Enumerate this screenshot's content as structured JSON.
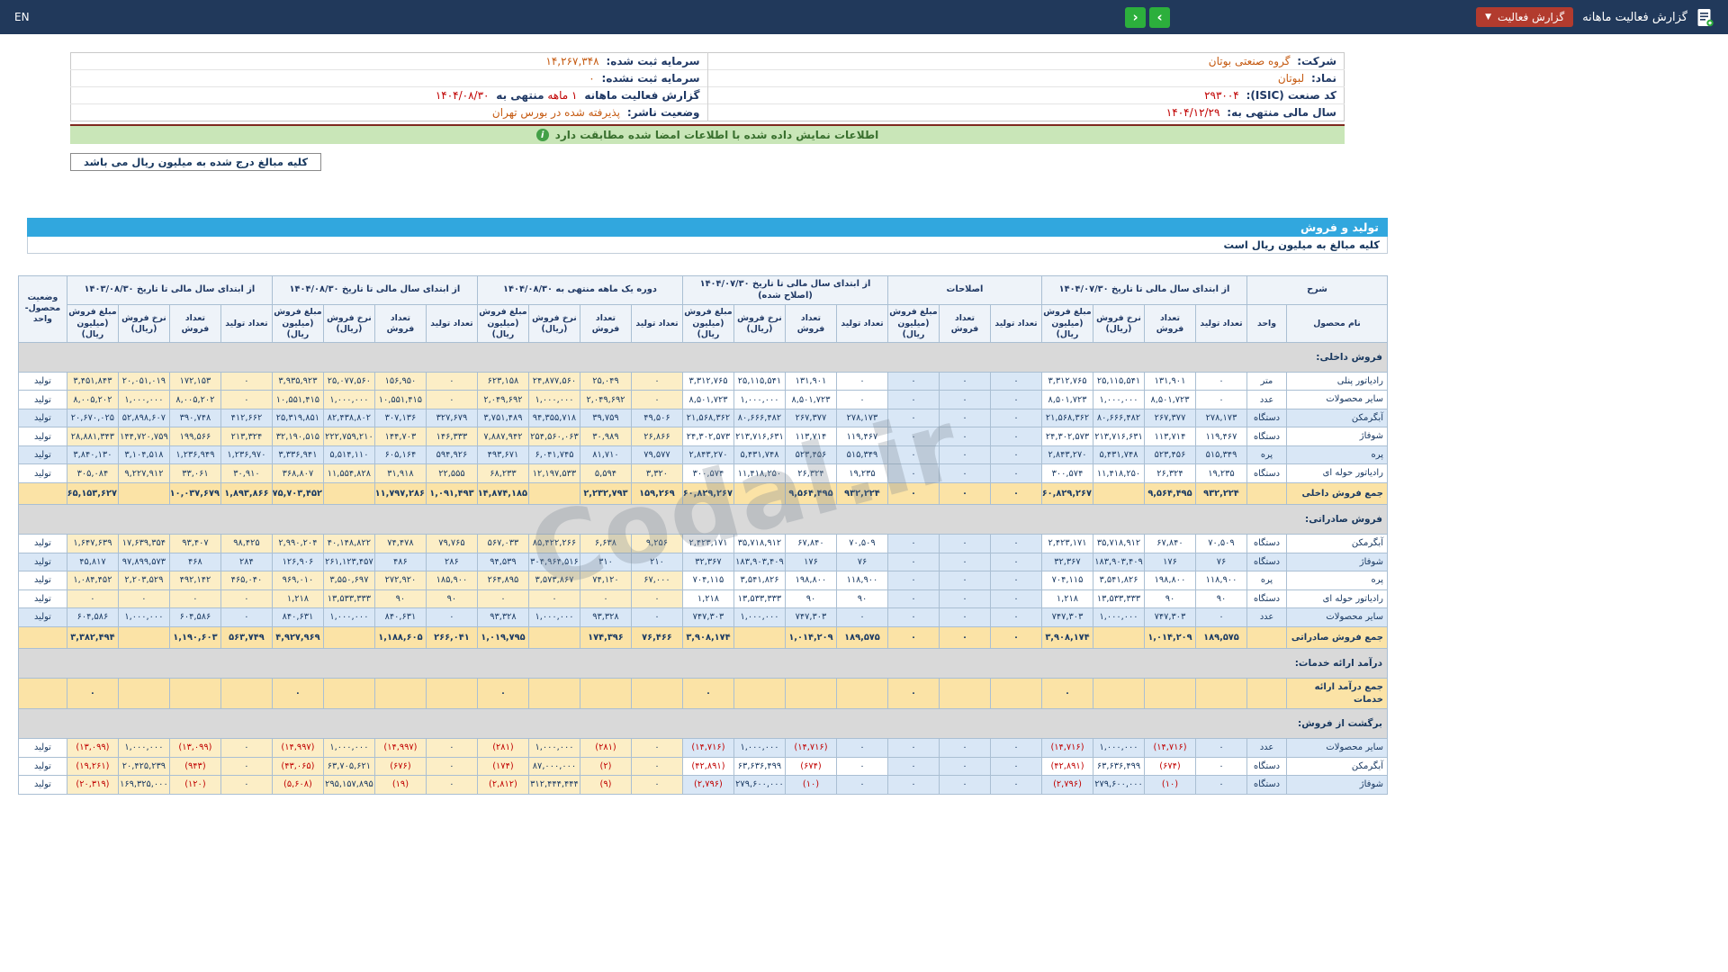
{
  "topbar": {
    "title": "گزارش فعالیت ماهانه",
    "report_button": "گزارش فعالیت",
    "next_arrow": "›",
    "prev_arrow": "‹",
    "language": "EN"
  },
  "info": {
    "rows": [
      {
        "rl": "شرکت:",
        "rv": "گروه صنعتی بوتان",
        "ll": "سرمایه ثبت شده:",
        "lv": "14,267,348"
      },
      {
        "rl": "نماد:",
        "rv": "لبوتان",
        "ll": "سرمایه ثبت نشده:",
        "lv": "0"
      },
      {
        "rl": "کد صنعت (ISIC):",
        "rv": "293004",
        "ll": "گزارش فعالیت ماهانه",
        "lp": "1 ماهه",
        "ll2": "منتهی به",
        "lv": "1404/08/30"
      },
      {
        "rl": "سال مالی منتهی به:",
        "rv": "1404/12/29",
        "ll": "وضعیت ناشر:",
        "lv": "پذیرفته شده در بورس تهران"
      }
    ]
  },
  "banner": {
    "text": "اطلاعات نمایش داده شده با اطلاعات امضا شده مطابقت دارد"
  },
  "amounts_note": "کلیه مبالغ درج شده به میلیون ریال می باشد",
  "watermark": "Codal.ir",
  "table": {
    "title": "تولید و فروش",
    "subtitle": "کلیه مبالغ به میلیون ریال است",
    "desc_header": "شرح",
    "name_header": "نام محصول",
    "unit_header": "واحد",
    "status_header": "وضعیت محصول-واحد",
    "groups": [
      {
        "title": "از ابتدای سال مالی تا تاریخ 1404/07/30",
        "cols": [
          "تعداد تولید",
          "تعداد فروش",
          "نرخ فروش (ریال)",
          "مبلغ فروش (میلیون ریال)"
        ]
      },
      {
        "title": "اصلاحات",
        "cols": [
          "تعداد تولید",
          "تعداد فروش",
          "مبلغ فروش (میلیون ریال)"
        ]
      },
      {
        "title": "از ابتدای سال مالی تا تاریخ 1404/07/30 (اصلاح شده)",
        "cols": [
          "تعداد تولید",
          "تعداد فروش",
          "نرخ فروش (ریال)",
          "مبلغ فروش (میلیون ریال)"
        ]
      },
      {
        "title": "دوره یک ماهه منتهی به 1404/08/30",
        "cols": [
          "تعداد تولید",
          "تعداد فروش",
          "نرخ فروش (ریال)",
          "مبلغ فروش (میلیون ریال)"
        ]
      },
      {
        "title": "از ابتدای سال مالی تا تاریخ 1404/08/30",
        "cols": [
          "تعداد تولید",
          "تعداد فروش",
          "نرخ فروش (ریال)",
          "مبلغ فروش (میلیون ریال)"
        ]
      },
      {
        "title": "از ابتدای سال مالی تا تاریخ 1403/08/30",
        "cols": [
          "تعداد تولید",
          "تعداد فروش",
          "نرخ فروش (ریال)",
          "مبلغ فروش (میلیون ریال)"
        ]
      }
    ],
    "rows": [
      {
        "type": "section",
        "label": "فروش داخلی:"
      },
      {
        "type": "data",
        "shade": "plain",
        "name": "رادیاتور پنلی",
        "unit": "متر",
        "status": "تولید",
        "cells": [
          "0",
          "131,901",
          "25,115,541",
          "3,312,765",
          "0",
          "0",
          "0",
          "0",
          "131,901",
          "25,115,541",
          "3,312,765",
          "0",
          "25,049",
          "24,877,560",
          "623,158",
          "0",
          "156,950",
          "25,077,560",
          "3,935,923",
          "0",
          "172,153",
          "20,051,019",
          "3,451,843"
        ]
      },
      {
        "type": "data",
        "shade": "plain",
        "name": "سایر محصولات",
        "unit": "عدد",
        "status": "تولید",
        "cells": [
          "0",
          "8,501,723",
          "1,000,000",
          "8,501,723",
          "0",
          "0",
          "0",
          "0",
          "8,501,723",
          "1,000,000",
          "8,501,723",
          "0",
          "2,049,692",
          "1,000,000",
          "2,049,692",
          "0",
          "10,551,415",
          "1,000,000",
          "10,551,415",
          "0",
          "8,005,202",
          "1,000,000",
          "8,005,202"
        ]
      },
      {
        "type": "data",
        "shade": "alt",
        "name": "آبگرمکن",
        "unit": "دستگاه",
        "status": "تولید",
        "cells": [
          "278,173",
          "267,377",
          "80,666,482",
          "21,568,362",
          "0",
          "0",
          "0",
          "278,173",
          "267,377",
          "80,666,482",
          "21,568,362",
          "49,506",
          "39,759",
          "94,355,718",
          "3,751,489",
          "327,679",
          "307,136",
          "82,438,802",
          "25,319,851",
          "412,662",
          "390,748",
          "52,898,607",
          "20,670,025"
        ]
      },
      {
        "type": "data",
        "shade": "plain",
        "name": "شوفاژ",
        "unit": "دستگاه",
        "status": "تولید",
        "cells": [
          "119,467",
          "113,714",
          "213,716,631",
          "24,302,573",
          "0",
          "0",
          "0",
          "119,467",
          "113,714",
          "213,716,631",
          "24,302,573",
          "26,866",
          "30,989",
          "254,560,063",
          "7,887,942",
          "146,333",
          "144,703",
          "222,759,210",
          "32,190,515",
          "213,324",
          "199,566",
          "144,720,759",
          "28,881,343"
        ]
      },
      {
        "type": "data",
        "shade": "alt",
        "name": "پره",
        "unit": "پره",
        "status": "تولید",
        "cells": [
          "515,349",
          "523,456",
          "5,431,748",
          "2,843,270",
          "0",
          "0",
          "0",
          "515,349",
          "523,456",
          "5,431,748",
          "2,843,270",
          "79,577",
          "81,710",
          "6,041,745",
          "493,671",
          "594,926",
          "605,164",
          "5,514,110",
          "3,336,941",
          "1,236,970",
          "1,236,949",
          "3,104,518",
          "3,840,130"
        ]
      },
      {
        "type": "data",
        "shade": "plain",
        "name": "رادیاتور حوله ای",
        "unit": "دستگاه",
        "status": "تولید",
        "cells": [
          "19,235",
          "26,324",
          "11,418,250",
          "300,574",
          "0",
          "0",
          "0",
          "19,235",
          "26,324",
          "11,418,250",
          "300,574",
          "3,320",
          "5,594",
          "12,197,533",
          "68,233",
          "22,555",
          "31,918",
          "11,554,828",
          "368,807",
          "30,910",
          "33,061",
          "9,227,912",
          "305,084"
        ]
      },
      {
        "type": "sum",
        "name": "جمع فروش داخلی",
        "unit": "",
        "status": "",
        "cells": [
          "932,224",
          "9,564,495",
          "",
          "60,829,267",
          "0",
          "0",
          "0",
          "932,224",
          "9,564,495",
          "",
          "60,829,267",
          "159,269",
          "2,232,793",
          "",
          "14,874,185",
          "1,091,493",
          "11,797,286",
          "",
          "75,703,452",
          "1,893,866",
          "10,037,679",
          "",
          "65,153,627"
        ]
      },
      {
        "type": "section",
        "label": "فروش صادراتی:"
      },
      {
        "type": "data",
        "shade": "plain",
        "name": "آبگرمکن",
        "unit": "دستگاه",
        "status": "تولید",
        "cells": [
          "70,509",
          "67,840",
          "35,718,912",
          "2,423,171",
          "0",
          "0",
          "0",
          "70,509",
          "67,840",
          "35,718,912",
          "2,423,171",
          "9,256",
          "6,638",
          "85,422,266",
          "567,033",
          "79,765",
          "74,478",
          "40,148,822",
          "2,990,204",
          "98,425",
          "93,407",
          "17,639,354",
          "1,647,639"
        ]
      },
      {
        "type": "data",
        "shade": "alt",
        "name": "شوفاژ",
        "unit": "دستگاه",
        "status": "تولید",
        "cells": [
          "76",
          "176",
          "183,903,409",
          "32,367",
          "0",
          "0",
          "0",
          "76",
          "176",
          "183,903,409",
          "32,367",
          "210",
          "310",
          "304,964,516",
          "94,539",
          "286",
          "486",
          "261,123,457",
          "126,906",
          "284",
          "468",
          "97,899,573",
          "45,817"
        ]
      },
      {
        "type": "data",
        "shade": "plain",
        "name": "پره",
        "unit": "پره",
        "status": "تولید",
        "cells": [
          "118,900",
          "198,800",
          "3,541,826",
          "704,115",
          "0",
          "0",
          "0",
          "118,900",
          "198,800",
          "3,541,826",
          "704,115",
          "67,000",
          "74,120",
          "3,573,867",
          "264,895",
          "185,900",
          "272,920",
          "3,550,697",
          "969,010",
          "465,040",
          "492,142",
          "2,203,529",
          "1,084,452"
        ]
      },
      {
        "type": "data",
        "shade": "plain",
        "name": "رادیاتور حوله ای",
        "unit": "دستگاه",
        "status": "تولید",
        "cells": [
          "90",
          "90",
          "13,533,333",
          "1,218",
          "0",
          "0",
          "0",
          "90",
          "90",
          "13,533,333",
          "1,218",
          "0",
          "0",
          "0",
          "0",
          "90",
          "90",
          "13,533,333",
          "1,218",
          "0",
          "0",
          "0",
          "0"
        ]
      },
      {
        "type": "data",
        "shade": "alt",
        "name": "سایر محصولات",
        "unit": "عدد",
        "status": "تولید",
        "cells": [
          "0",
          "747,303",
          "1,000,000",
          "747,303",
          "0",
          "0",
          "0",
          "0",
          "747,303",
          "1,000,000",
          "747,303",
          "0",
          "93,328",
          "1,000,000",
          "93,328",
          "0",
          "840,631",
          "1,000,000",
          "840,631",
          "0",
          "604,586",
          "1,000,000",
          "604,586"
        ]
      },
      {
        "type": "sum",
        "name": "جمع فروش صادراتی",
        "unit": "",
        "status": "",
        "cells": [
          "189,575",
          "1,014,209",
          "",
          "3,908,174",
          "0",
          "0",
          "0",
          "189,575",
          "1,014,209",
          "",
          "3,908,174",
          "76,466",
          "174,396",
          "",
          "1,019,795",
          "266,041",
          "1,188,605",
          "",
          "4,927,969",
          "563,749",
          "1,190,603",
          "",
          "3,382,494"
        ]
      },
      {
        "type": "section",
        "label": "درآمد ارائه خدمات:"
      },
      {
        "type": "sum",
        "name": "جمع درآمد ارائه خدمات",
        "unit": "",
        "status": "",
        "cells": [
          "",
          "",
          "",
          "0",
          "",
          "",
          "0",
          "",
          "",
          "",
          "0",
          "",
          "",
          "",
          "0",
          "",
          "",
          "",
          "0",
          "",
          "",
          "",
          "0"
        ]
      },
      {
        "type": "section",
        "label": "برگشت از فروش:"
      },
      {
        "type": "data",
        "shade": "mixed",
        "name": "سایر محصولات",
        "unit": "عدد",
        "status": "تولید",
        "cells": [
          "0",
          "(14,716)",
          "1,000,000",
          "(14,716)",
          "0",
          "0",
          "0",
          "0",
          "(14,716)",
          "1,000,000",
          "(14,716)",
          "0",
          "(281)",
          "1,000,000",
          "(281)",
          "0",
          "(14,997)",
          "1,000,000",
          "(14,997)",
          "0",
          "(13,099)",
          "1,000,000",
          "(13,099)"
        ]
      },
      {
        "type": "data",
        "shade": "plain",
        "name": "آبگرمکن",
        "unit": "دستگاه",
        "status": "تولید",
        "cells": [
          "0",
          "(674)",
          "63,636,499",
          "(42,891)",
          "0",
          "0",
          "0",
          "0",
          "(674)",
          "63,636,499",
          "(42,891)",
          "0",
          "(2)",
          "87,000,000",
          "(174)",
          "0",
          "(676)",
          "63,705,621",
          "(43,065)",
          "0",
          "(943)",
          "20,425,239",
          "(19,261)"
        ]
      },
      {
        "type": "data",
        "shade": "mixed",
        "name": "شوفاژ",
        "unit": "دستگاه",
        "status": "تولید",
        "cells": [
          "0",
          "(10)",
          "279,600,000",
          "(2,796)",
          "0",
          "0",
          "0",
          "0",
          "(10)",
          "279,600,000",
          "(2,796)",
          "0",
          "(9)",
          "312,444,444",
          "(2,812)",
          "0",
          "(19)",
          "295,157,895",
          "(5,608)",
          "0",
          "(120)",
          "169,325,000",
          "(20,319)"
        ]
      }
    ]
  }
}
